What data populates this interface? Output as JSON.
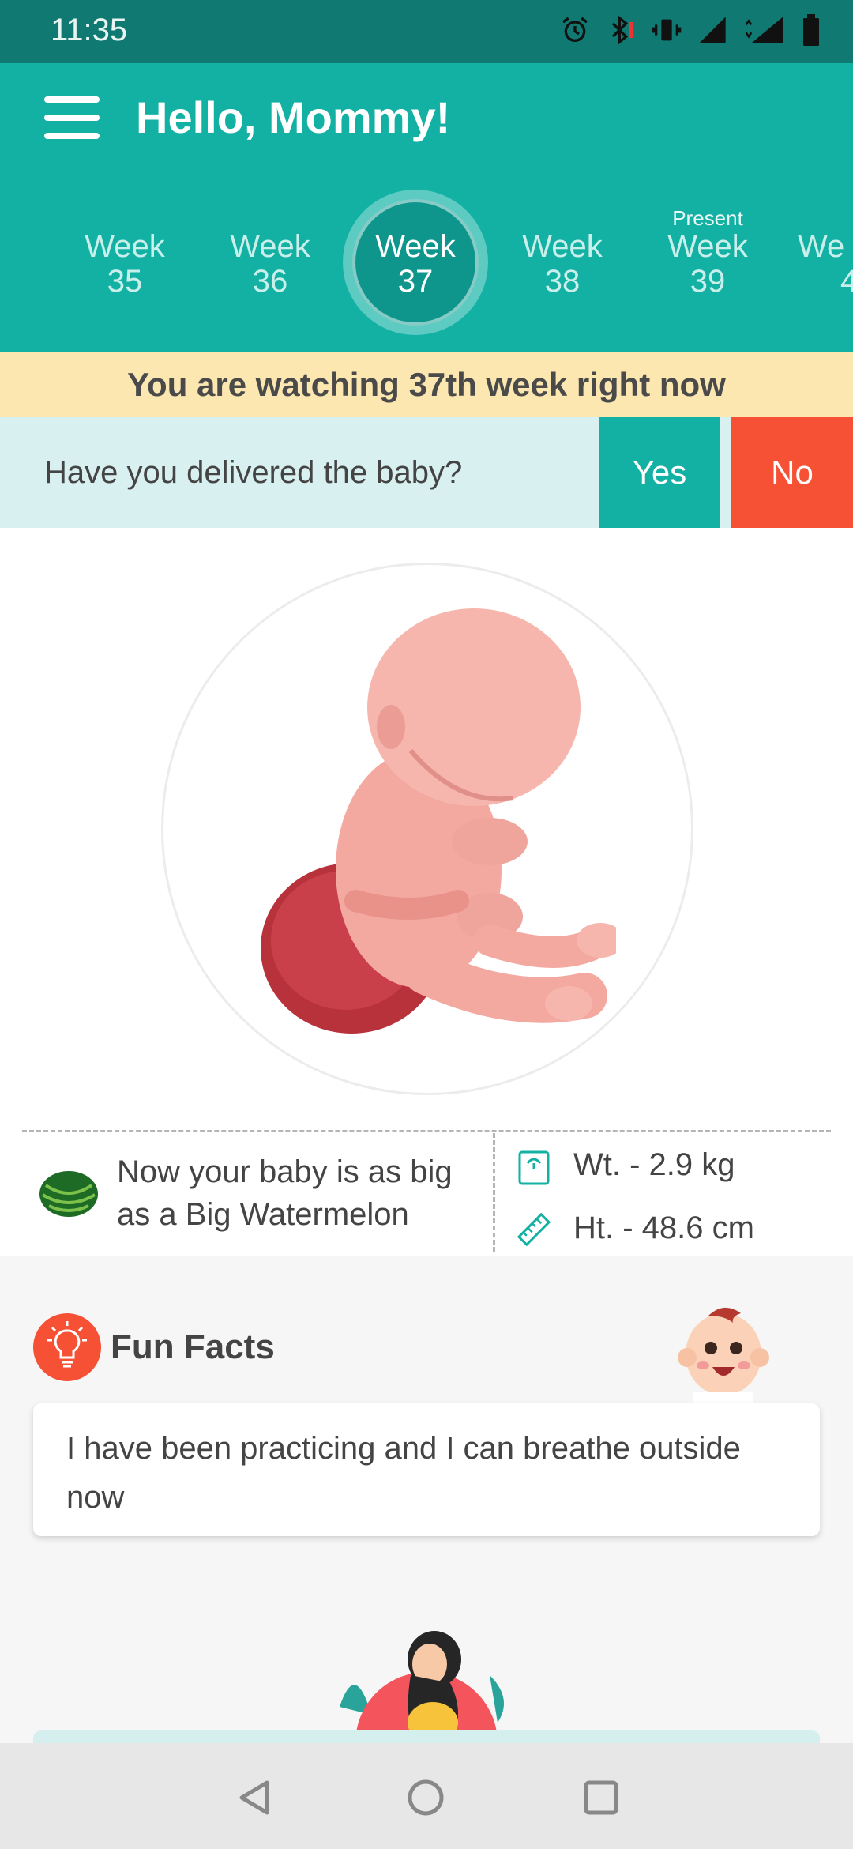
{
  "status_bar": {
    "time": "11:35",
    "network": "4G"
  },
  "header": {
    "title": "Hello, Mommy!"
  },
  "weeks": [
    {
      "label": "Week",
      "number": "35",
      "tag": ""
    },
    {
      "label": "Week",
      "number": "36",
      "tag": ""
    },
    {
      "label": "Week",
      "number": "37",
      "tag": ""
    },
    {
      "label": "Week",
      "number": "38",
      "tag": ""
    },
    {
      "label": "Week",
      "number": "39",
      "tag": "Present"
    },
    {
      "label": "We",
      "number": "4",
      "tag": ""
    }
  ],
  "banner": {
    "text": "You are watching 37th week right now"
  },
  "delivery": {
    "question": "Have you delivered the baby?",
    "yes": "Yes",
    "no": "No"
  },
  "baby_size": {
    "text": "Now your baby is as big as a Big Watermelon",
    "weight": "Wt. - 2.9 kg",
    "height": "Ht. - 48.6 cm"
  },
  "fun_facts": {
    "title": "Fun Facts",
    "text": "I have been practicing and I can breathe outside now"
  },
  "colors": {
    "primary": "#13b0a4",
    "status": "#107a72",
    "accent": "#f65134",
    "banner": "#fce7b0"
  },
  "icons": {
    "menu": "hamburger-menu-icon",
    "weight": "scale-icon",
    "height": "ruler-icon",
    "facts": "lightbulb-icon"
  }
}
